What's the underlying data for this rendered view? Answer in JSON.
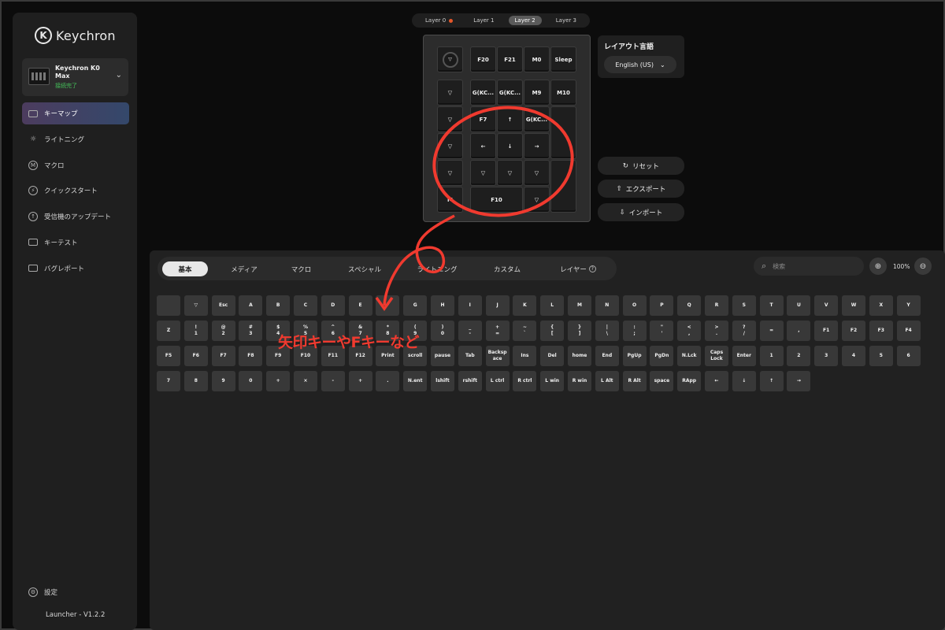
{
  "sidebar": {
    "logo": "Keychron",
    "logo_mark": "K",
    "device_name": "Keychron K0 Max",
    "device_status": "接続完了",
    "items": [
      {
        "label": "キーマップ",
        "icon": "⌨"
      },
      {
        "label": "ライトニング",
        "icon": "☼"
      },
      {
        "label": "マクロ",
        "icon": "M"
      },
      {
        "label": "クイックスタート",
        "icon": "⚡"
      },
      {
        "label": "受信機のアップデート",
        "icon": "↑"
      },
      {
        "label": "キーテスト",
        "icon": "☰"
      },
      {
        "label": "バグレポート",
        "icon": "▭"
      }
    ],
    "settings_label": "設定",
    "version": "Launcher - V1.2.2"
  },
  "layers": [
    "Layer 0",
    "Layer 1",
    "Layer 2",
    "Layer 3"
  ],
  "keyboard_keys": [
    "",
    "F20",
    "F21",
    "M0",
    "Sleep",
    "▽",
    "G(KC...",
    "G(KC...",
    "M9",
    "M10",
    "▽",
    "F7",
    "↑",
    "G(KC...",
    "",
    "▽",
    "←",
    "↓",
    "→",
    "▽",
    "▽",
    "▽",
    "▽",
    "M",
    "F10",
    "▽",
    ""
  ],
  "layout_panel": {
    "title": "レイアウト言語",
    "selected": "English (US)"
  },
  "actions": {
    "reset": "リセット",
    "export": "エクスポート",
    "import": "インポート"
  },
  "categories": [
    "基本",
    "メディア",
    "マクロ",
    "スペシャル",
    "ライトニング",
    "カスタム",
    "レイヤー"
  ],
  "search": {
    "placeholder": "検索"
  },
  "zoom": "100%",
  "palette_rows": [
    [
      "",
      "▽",
      "Esc",
      "A",
      "B",
      "C",
      "D",
      "E",
      "F",
      "G",
      "H",
      "I",
      "J",
      "K",
      "L",
      "M",
      "N",
      "O",
      "P",
      "Q",
      "R",
      "S",
      "T",
      "U",
      "V",
      "W",
      "X",
      "Y"
    ],
    [
      "Z",
      "!\n1",
      "@\n2",
      "#\n3",
      "$\n4",
      "%\n5",
      "^\n6",
      "&\n7",
      "*\n8",
      "(\n9",
      ")\n0",
      "_\n-",
      "+\n=",
      "~\n`",
      "{\n[",
      "}\n]",
      "|\n\\",
      ":\n;",
      "\"\n'",
      "<\n,",
      ">\n.",
      "?\n/",
      "=",
      ",",
      "F1",
      "F2",
      "F3",
      "F4"
    ],
    [
      "F5",
      "F6",
      "F7",
      "F8",
      "F9",
      "F10",
      "F11",
      "F12",
      "Print",
      "scroll",
      "pause",
      "Tab",
      "Backsp\nace",
      "Ins",
      "Del",
      "home",
      "End",
      "PgUp",
      "PgDn",
      "N.Lck",
      "Caps\nLock",
      "Enter",
      "1",
      "2",
      "3",
      "4",
      "5",
      "6"
    ],
    [
      "7",
      "8",
      "9",
      "0",
      "+",
      "×",
      "-",
      "+",
      ".",
      "N.ent",
      "lshift",
      "rshift",
      "L ctrl",
      "R ctrl",
      "L win",
      "R win",
      "L Alt",
      "R Alt",
      "space",
      "RApp",
      "←",
      "↓",
      "↑",
      "→"
    ]
  ],
  "annotation": {
    "text": "矢印キーやFキーなど",
    "color": "#f03a2f"
  }
}
